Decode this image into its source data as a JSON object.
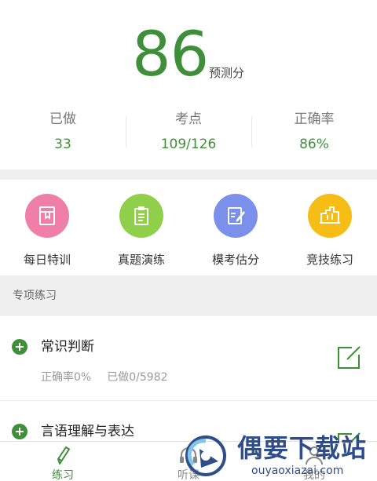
{
  "score": {
    "value": "86",
    "unit": "预测分"
  },
  "stats": [
    {
      "label": "已做",
      "value": "33"
    },
    {
      "label": "考点",
      "value": "109/126"
    },
    {
      "label": "正确率",
      "value": "86%"
    }
  ],
  "features": [
    {
      "label": "每日特训",
      "icon": "calendar-book-icon",
      "color": "#ef7fa6"
    },
    {
      "label": "真题演练",
      "icon": "clipboard-icon",
      "color": "#8fcf4a"
    },
    {
      "label": "模考估分",
      "icon": "edit-note-icon",
      "color": "#7b90ea"
    },
    {
      "label": "竞技练习",
      "icon": "arena-icon",
      "color": "#f6bd16"
    }
  ],
  "section": {
    "title": "专项练习"
  },
  "practice_items": [
    {
      "title": "常识判断",
      "accuracy": "正确率0%",
      "done": "已做0/5982"
    },
    {
      "title": "言语理解与表达"
    }
  ],
  "tabs": [
    {
      "label": "练习",
      "icon": "pencil-icon",
      "active": true
    },
    {
      "label": "听课",
      "icon": "headphones-icon",
      "active": false
    },
    {
      "label": "我的",
      "icon": "person-icon",
      "active": false
    }
  ],
  "watermark": {
    "title": "偶要下载站",
    "url": "ouyaoxiazai.com"
  },
  "colors": {
    "accent": "#3f8f3a",
    "brand": "#2f4d88"
  }
}
